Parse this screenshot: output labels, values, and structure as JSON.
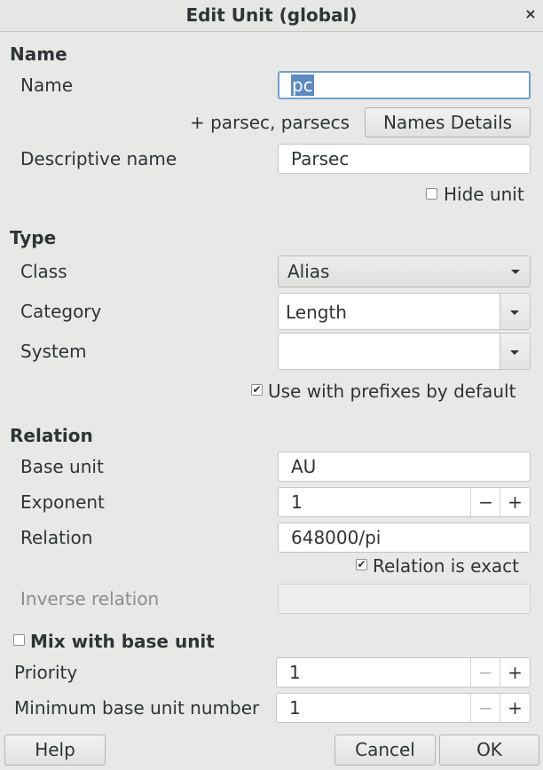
{
  "window": {
    "title": "Edit Unit (global)",
    "close_glyph": "×"
  },
  "name_section": {
    "heading": "Name",
    "name_label": "Name",
    "name_value": "pc",
    "plural_names": "+ parsec, parsecs",
    "names_details_button": "Names Details",
    "descriptive_label": "Descriptive name",
    "descriptive_value": "Parsec",
    "hide_unit_label": "Hide unit",
    "hide_unit_checked": false
  },
  "type_section": {
    "heading": "Type",
    "class_label": "Class",
    "class_value": "Alias",
    "category_label": "Category",
    "category_value": "Length",
    "system_label": "System",
    "system_value": "",
    "prefixes_label": "Use with prefixes by default",
    "prefixes_checked": true
  },
  "relation_section": {
    "heading": "Relation",
    "base_unit_label": "Base unit",
    "base_unit_value": "AU",
    "exponent_label": "Exponent",
    "exponent_value": "1",
    "relation_label": "Relation",
    "relation_value": "648000/pi",
    "exact_label": "Relation is exact",
    "exact_checked": true,
    "inverse_label": "Inverse relation",
    "inverse_value": ""
  },
  "mix_section": {
    "mix_label": "Mix with base unit",
    "mix_checked": false,
    "priority_label": "Priority",
    "priority_value": "1",
    "min_base_label": "Minimum base unit number",
    "min_base_value": "1"
  },
  "buttons": {
    "help": "Help",
    "cancel": "Cancel",
    "ok": "OK"
  },
  "spin_glyphs": {
    "minus": "−",
    "plus": "+"
  },
  "check_glyph": "✔"
}
